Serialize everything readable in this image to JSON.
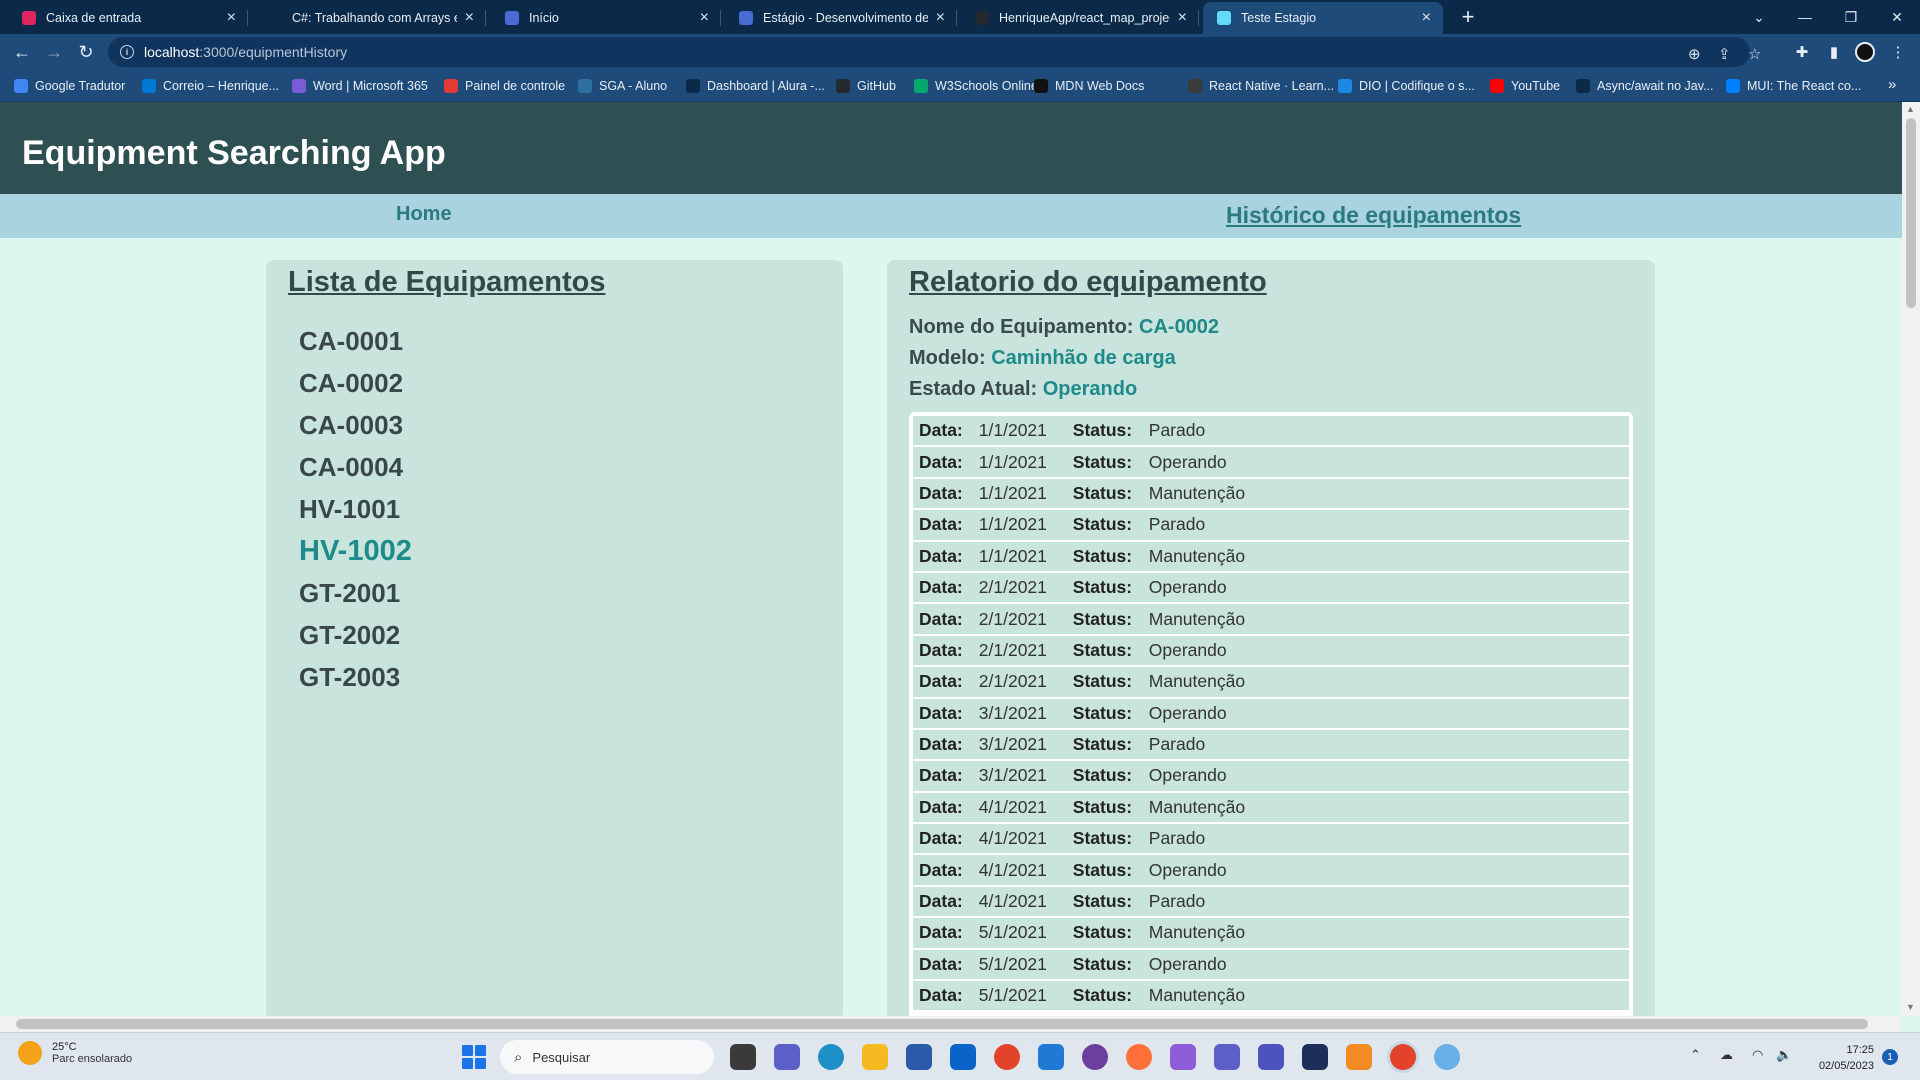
{
  "browser": {
    "tabs": [
      {
        "title": "Caixa de entrada",
        "icon": "mail-icon",
        "color": "#e0245e"
      },
      {
        "title": "C#: Trabalhando com Arrays e Co",
        "icon": "alura-icon",
        "color": "#0b2a4a"
      },
      {
        "title": "Início",
        "icon": "page-icon",
        "color": "#4a6cd4"
      },
      {
        "title": "Estágio - Desenvolvimento de Sis",
        "icon": "page-icon",
        "color": "#4a6cd4"
      },
      {
        "title": "HenriqueAgp/react_map_project",
        "icon": "github-icon",
        "color": "#24292e"
      },
      {
        "title": "Teste Estagio",
        "icon": "react-icon",
        "color": "#61dafb"
      }
    ],
    "new_tab": "+",
    "url_host": "localhost",
    "url_path": ":3000/equipmentHistory",
    "bookmarks": [
      {
        "label": "Google Tradutor",
        "color": "#4285f4"
      },
      {
        "label": "Correio – Henrique...",
        "color": "#0078d4"
      },
      {
        "label": "Word | Microsoft 365",
        "color": "#7a5cd6"
      },
      {
        "label": "Painel de controle",
        "color": "#e53935"
      },
      {
        "label": "SGA - Aluno",
        "color": "#2d6f9e"
      },
      {
        "label": "Dashboard | Alura -...",
        "color": "#0b2a4a"
      },
      {
        "label": "GitHub",
        "color": "#24292e"
      },
      {
        "label": "W3Schools Online...",
        "color": "#04aa6d"
      },
      {
        "label": "MDN Web Docs",
        "color": "#111111"
      },
      {
        "label": "React Native · Learn...",
        "color": "#3b3b3b"
      },
      {
        "label": "DIO | Codifique o s...",
        "color": "#1e88e5"
      },
      {
        "label": "YouTube",
        "color": "#ff0000"
      },
      {
        "label": "Async/await no Jav...",
        "color": "#0b2a4a"
      },
      {
        "label": "MUI: The React co...",
        "color": "#007fff"
      }
    ],
    "bookmarks_more": "»"
  },
  "app": {
    "title": "Equipment Searching App",
    "nav": {
      "home": "Home",
      "history": "Histórico de equipamentos"
    },
    "list_title": "Lista de Equipamentos",
    "equipment": [
      "CA-0001",
      "CA-0002",
      "CA-0003",
      "CA-0004",
      "HV-1001",
      "HV-1002",
      "GT-2001",
      "GT-2002",
      "GT-2003"
    ],
    "hovered_equipment": "HV-1002",
    "report": {
      "title": "Relatorio do equipamento",
      "name_label": "Nome do Equipamento:",
      "name_value": "CA-0002",
      "model_label": "Modelo:",
      "model_value": "Caminhão de carga",
      "state_label": "Estado Atual:",
      "state_value": "Operando",
      "date_label": "Data:",
      "status_label": "Status:",
      "records": [
        {
          "date": "1/1/2021",
          "status": "Parado"
        },
        {
          "date": "1/1/2021",
          "status": "Operando"
        },
        {
          "date": "1/1/2021",
          "status": "Manutenção"
        },
        {
          "date": "1/1/2021",
          "status": "Parado"
        },
        {
          "date": "1/1/2021",
          "status": "Manutenção"
        },
        {
          "date": "2/1/2021",
          "status": "Operando"
        },
        {
          "date": "2/1/2021",
          "status": "Manutenção"
        },
        {
          "date": "2/1/2021",
          "status": "Operando"
        },
        {
          "date": "2/1/2021",
          "status": "Manutenção"
        },
        {
          "date": "3/1/2021",
          "status": "Operando"
        },
        {
          "date": "3/1/2021",
          "status": "Parado"
        },
        {
          "date": "3/1/2021",
          "status": "Operando"
        },
        {
          "date": "4/1/2021",
          "status": "Manutenção"
        },
        {
          "date": "4/1/2021",
          "status": "Parado"
        },
        {
          "date": "4/1/2021",
          "status": "Operando"
        },
        {
          "date": "4/1/2021",
          "status": "Parado"
        },
        {
          "date": "5/1/2021",
          "status": "Manutenção"
        },
        {
          "date": "5/1/2021",
          "status": "Operando"
        },
        {
          "date": "5/1/2021",
          "status": "Manutenção"
        }
      ]
    }
  },
  "taskbar": {
    "weather_temp": "25°C",
    "weather_condition": "Parc ensolarado",
    "search_placeholder": "Pesquisar",
    "time": "17:25",
    "date": "02/05/2023",
    "notifications": "1"
  }
}
